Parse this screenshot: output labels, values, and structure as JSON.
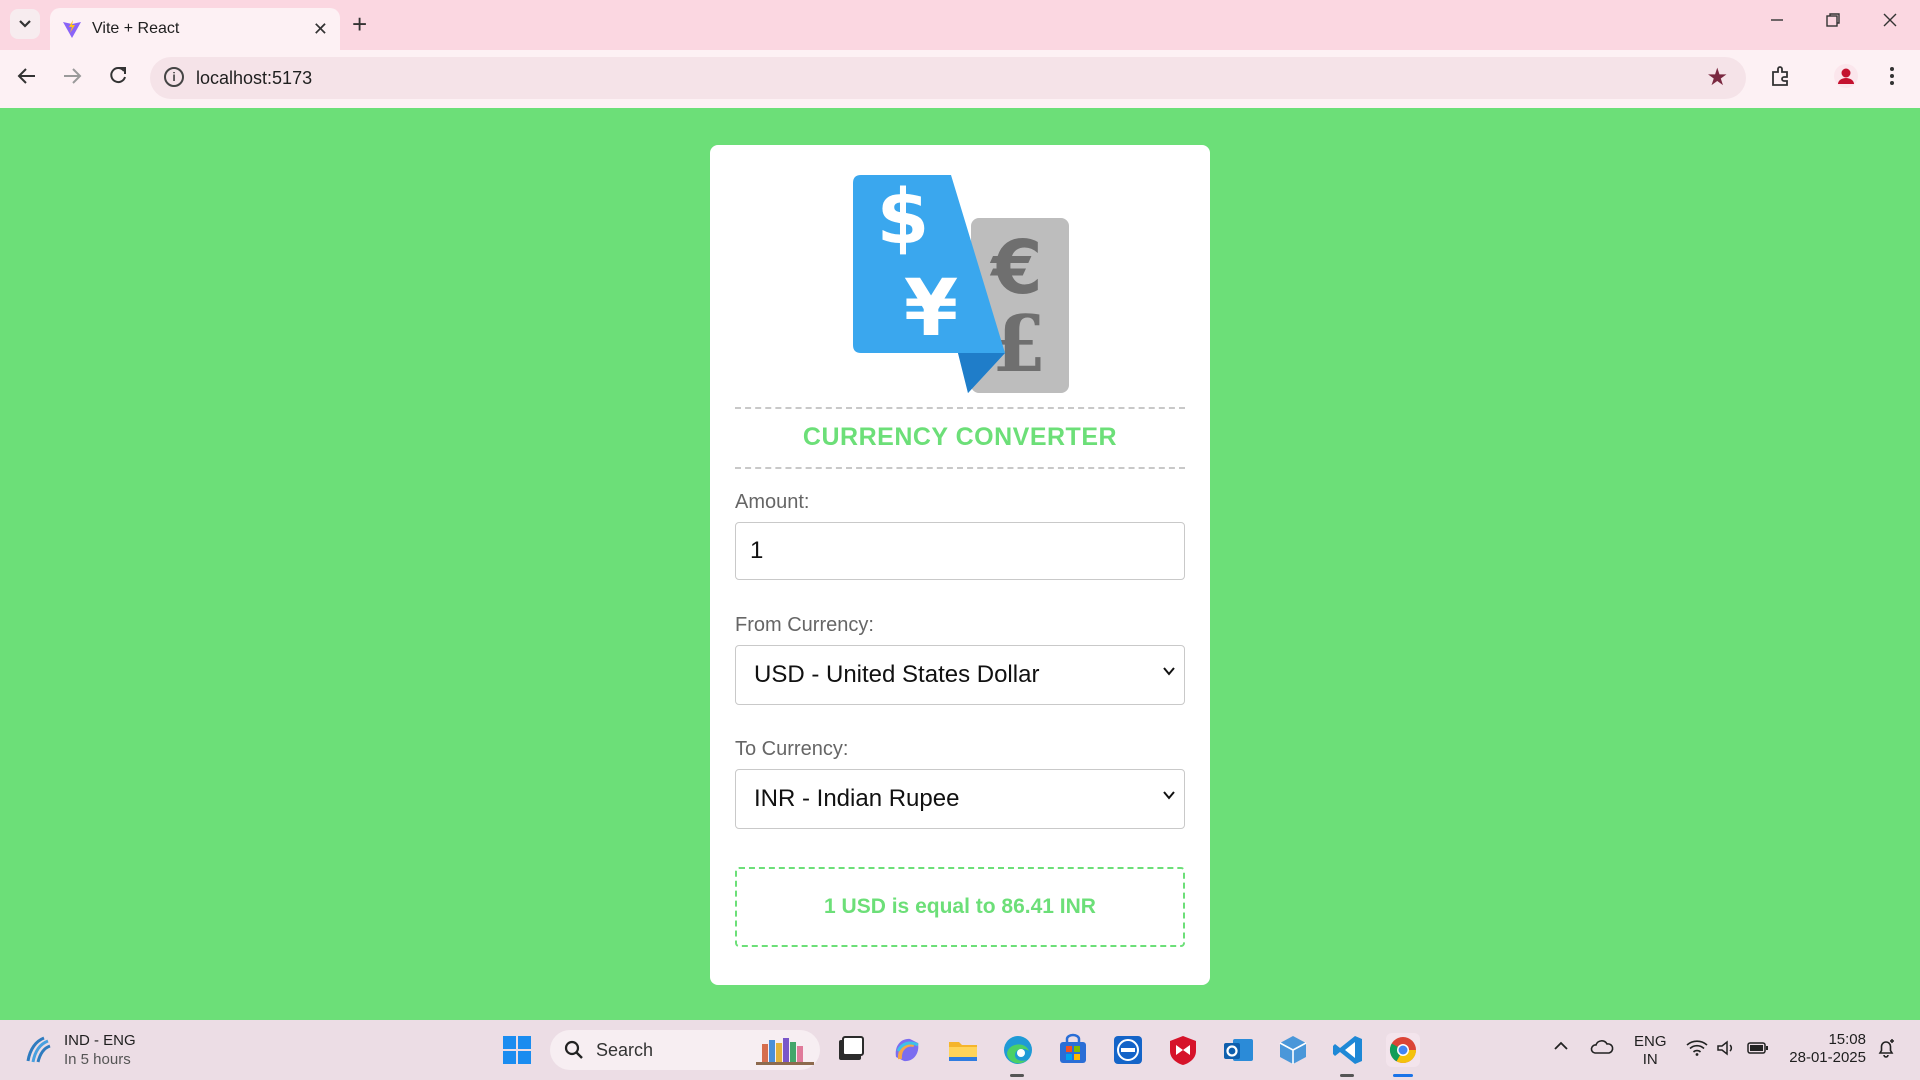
{
  "browser": {
    "tab_title": "Vite + React",
    "url": "localhost:5173"
  },
  "app": {
    "heading": "CURRENCY CONVERTER",
    "amount_label": "Amount:",
    "amount_value": "1",
    "from_label": "From Currency:",
    "from_value": "USD - United States Dollar",
    "to_label": "To Currency:",
    "to_value": "INR - Indian Rupee",
    "result": "1 USD is equal to 86.41 INR",
    "logo_symbols": {
      "dollar": "$",
      "yen": "¥",
      "euro": "€",
      "pound": "£"
    },
    "accent_color": "#6cdf78"
  },
  "taskbar": {
    "weather_title": "IND - ENG",
    "weather_sub": "In 5 hours",
    "search_label": "Search",
    "lang_top": "ENG",
    "lang_bottom": "IN",
    "time": "15:08",
    "date": "28-01-2025",
    "icons": [
      "windows-start-icon",
      "search-icon",
      "task-view-icon",
      "copilot-icon",
      "file-explorer-icon",
      "edge-icon",
      "microsoft-store-icon",
      "dell-icon",
      "mcafee-icon",
      "outlook-icon",
      "3d-box-icon",
      "vscode-icon",
      "chrome-icon"
    ]
  }
}
